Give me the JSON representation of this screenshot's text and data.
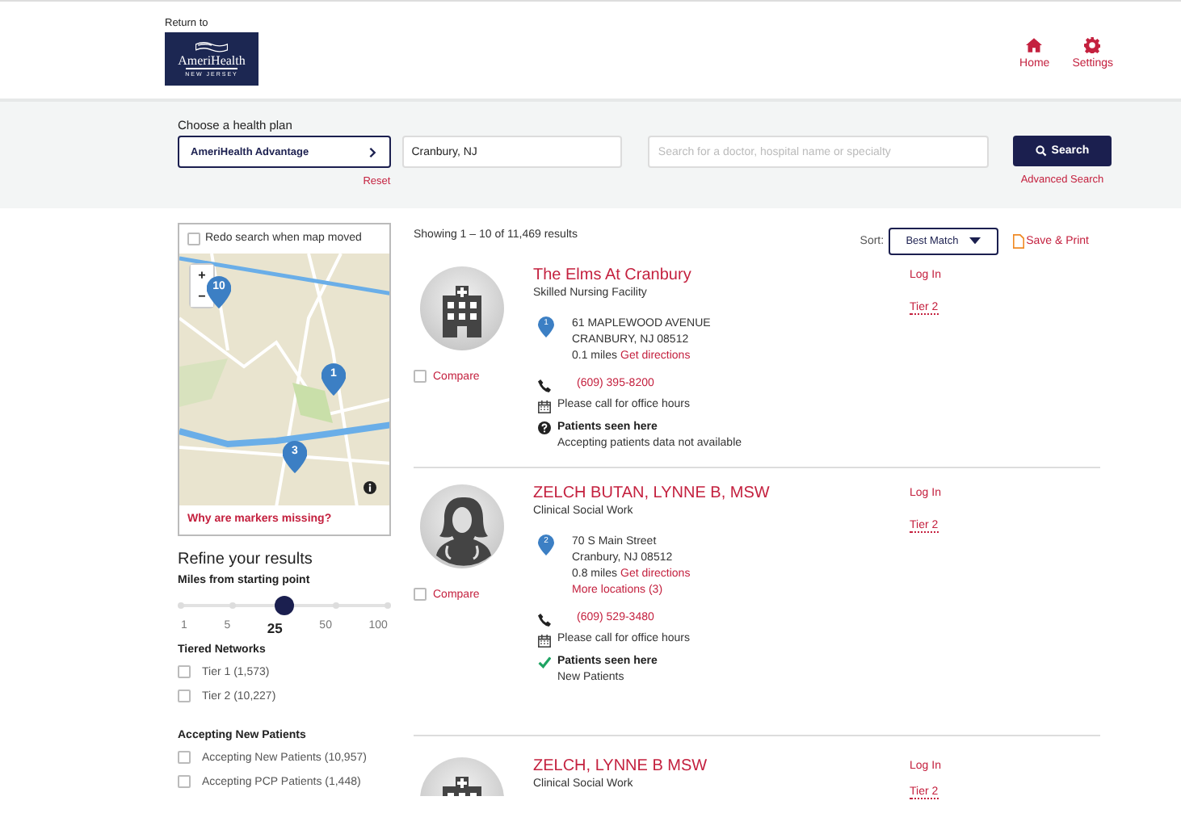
{
  "header": {
    "return_label": "Return to",
    "logo": {
      "name": "AmeriHealth",
      "sub": "NEW JERSEY"
    },
    "nav": [
      {
        "kind": "home",
        "label": "Home"
      },
      {
        "kind": "settings",
        "label": "Settings"
      }
    ]
  },
  "search": {
    "plan_label": "Choose a health plan",
    "plan_value": "AmeriHealth Advantage",
    "reset": "Reset",
    "location_value": "Cranbury, NJ",
    "query_placeholder": "Search for a doctor, hospital name or specialty",
    "search_button": "Search",
    "advanced_link": "Advanced Search"
  },
  "map": {
    "redo": {
      "label": "Redo search when map moved",
      "checked": false
    },
    "zoom_in": "+",
    "zoom_out": "−",
    "markers": [
      {
        "label": "10"
      },
      {
        "label": "1"
      },
      {
        "label": "3"
      }
    ],
    "missing_link": "Why are markers missing?"
  },
  "refine": {
    "title": "Refine your results",
    "distance": {
      "label": "Miles from starting point",
      "level": 0.5,
      "options": [
        {
          "label": "1",
          "selected": false
        },
        {
          "label": "5",
          "selected": false
        },
        {
          "label": "25",
          "selected": true
        },
        {
          "label": "50",
          "selected": false
        },
        {
          "label": "100",
          "selected": false
        }
      ]
    },
    "filters": [
      {
        "title": "Tiered Networks",
        "options": [
          {
            "label": "Tier 1 (1,573)",
            "checked": false
          },
          {
            "label": "Tier 2 (10,227)",
            "checked": false
          }
        ]
      },
      {
        "title": "Accepting New Patients",
        "options": [
          {
            "label": "Accepting New Patients (10,957)",
            "checked": false
          },
          {
            "label": "Accepting PCP Patients (1,448)",
            "checked": false
          }
        ]
      }
    ]
  },
  "results": {
    "summary": "Showing 1 – 10 of 11,469 results",
    "sort": {
      "label": "Sort:",
      "value": "Best Match"
    },
    "save_print": "Save & Print",
    "items": [
      {
        "kind": "facility",
        "name": "The Elms At Cranbury",
        "specialty": "Skilled Nursing Facility",
        "compare": {
          "label": "Compare",
          "checked": false
        },
        "marker": "1",
        "address_lines": [
          "61 MAPLEWOOD AVENUE",
          "CRANBURY, NJ 08512"
        ],
        "distance": "0.1 miles",
        "directions": "Get directions",
        "phone": "(609) 395-8200",
        "hours": "Please call for office hours",
        "patients": {
          "kind": "unknown",
          "title": "Patients seen here",
          "detail": "Accepting patients data not available"
        },
        "login": "Log In",
        "tier": "Tier 2"
      },
      {
        "kind": "person",
        "name": "ZELCH BUTAN, LYNNE B, MSW",
        "specialty": "Clinical Social Work",
        "compare": {
          "label": "Compare",
          "checked": false
        },
        "marker": "2",
        "address_lines": [
          "70 S Main Street",
          "Cranbury, NJ 08512"
        ],
        "distance": "0.8 miles",
        "directions": "Get directions",
        "more_locations": "More locations (3)",
        "phone": "(609) 529-3480",
        "hours": "Please call for office hours",
        "patients": {
          "kind": "accepting",
          "title": "Patients seen here",
          "detail": "New Patients"
        },
        "login": "Log In",
        "tier": "Tier 2"
      },
      {
        "kind": "facility",
        "name": "ZELCH, LYNNE B MSW",
        "specialty": "Clinical Social Work",
        "login": "Log In",
        "tier": "Tier 2"
      }
    ]
  }
}
